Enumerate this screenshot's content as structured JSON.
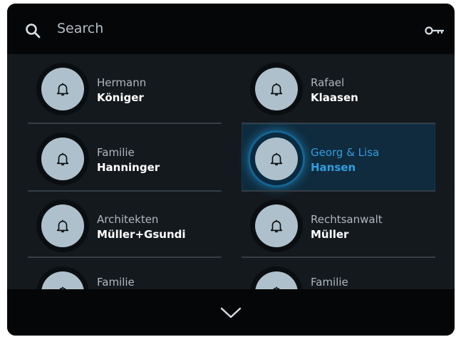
{
  "search": {
    "label": "Search",
    "icon": "search-icon"
  },
  "header": {
    "key_icon": "key-icon"
  },
  "entries": [
    {
      "first": "Hermann",
      "last": "Königer",
      "icon": "bell-icon",
      "active": false
    },
    {
      "first": "Rafael",
      "last": "Klaasen",
      "icon": "bell-icon",
      "active": false
    },
    {
      "first": "Familie",
      "last": "Hanninger",
      "icon": "bell-icon",
      "active": false
    },
    {
      "first": "Georg & Lisa",
      "last": "Hansen",
      "icon": "bell-icon",
      "active": true
    },
    {
      "first": "Architekten",
      "last": "Müller+Gsundi",
      "icon": "bell-icon",
      "active": false
    },
    {
      "first": "Rechtsanwalt",
      "last": "Müller",
      "icon": "bell-icon",
      "active": false
    },
    {
      "first": "Familie",
      "last": "",
      "icon": "bell-icon",
      "active": false
    },
    {
      "first": "Familie",
      "last": "",
      "icon": "bell-icon",
      "active": false
    }
  ],
  "footer": {
    "icon": "chevron-down-icon"
  },
  "colors": {
    "accent": "#2f9ee0",
    "background": "#14191e",
    "bar": "#050607"
  }
}
